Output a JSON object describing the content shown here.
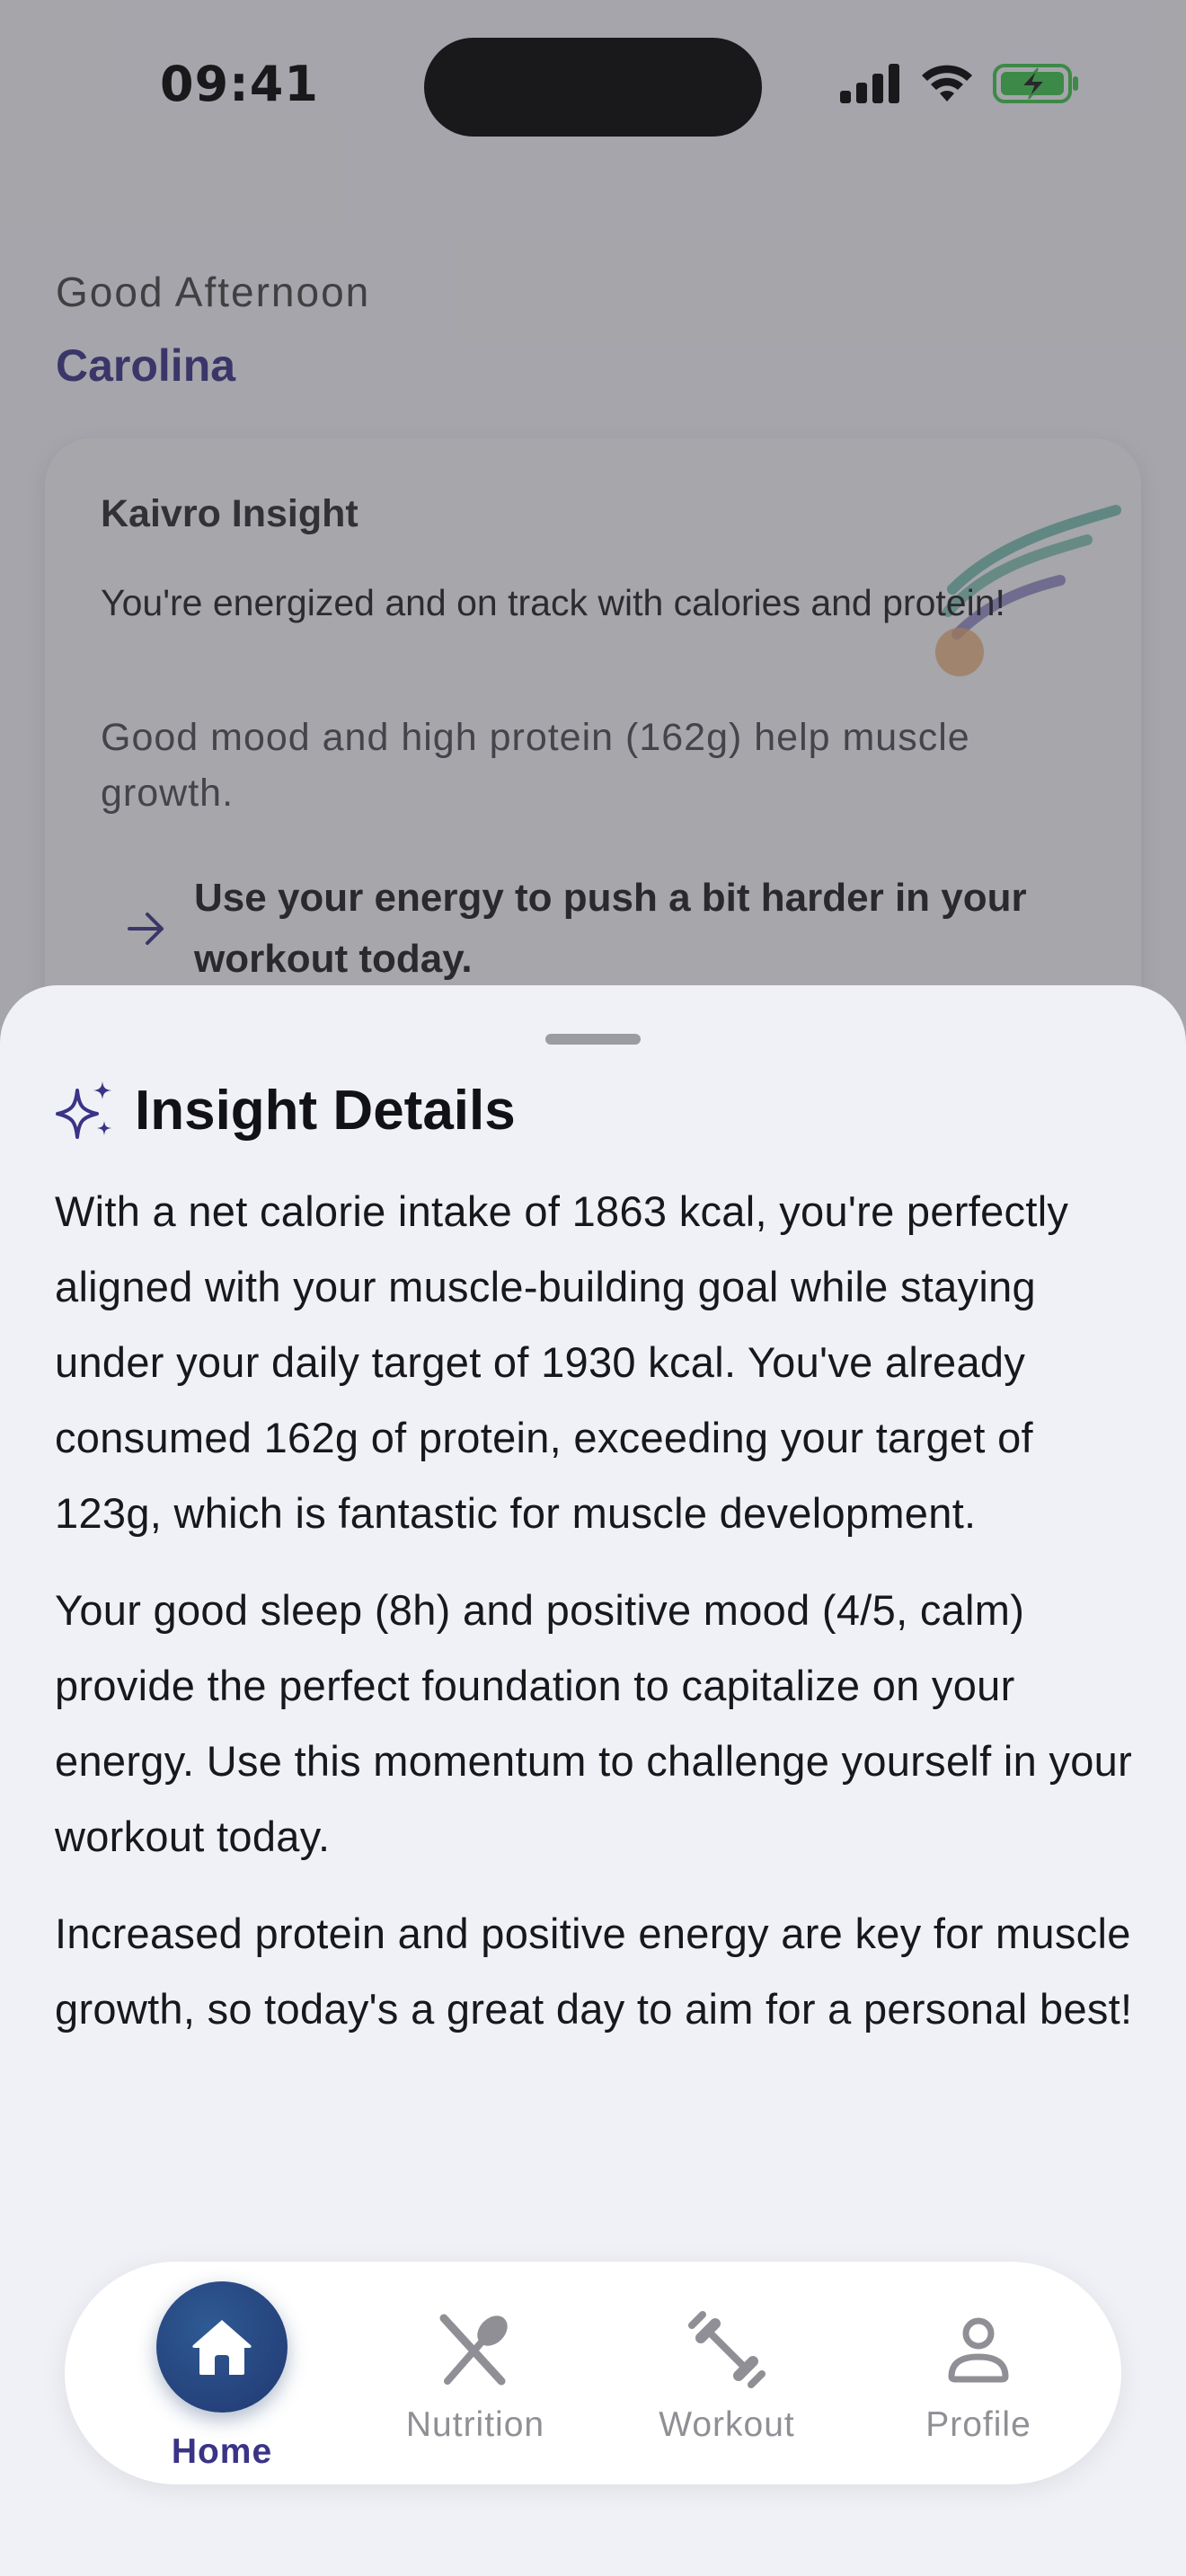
{
  "status_bar": {
    "time": "09:41",
    "icons": [
      "signal-icon",
      "wifi-icon",
      "battery-charging-icon"
    ]
  },
  "home": {
    "greeting": "Good Afternoon",
    "user_name": "Carolina",
    "insight_card": {
      "title": "Kaivro Insight",
      "summary": "You're energized and on track with calories and protein!",
      "detail": "Good mood and high protein (162g) help muscle growth.",
      "action": "Use your energy to push a bit harder in your workout today."
    }
  },
  "sheet": {
    "title": "Insight Details",
    "icon": "sparkles-icon",
    "paragraphs": [
      "With a net calorie intake of 1863 kcal, you're perfectly aligned with your muscle-building goal while staying under your daily target of 1930 kcal. You've already consumed 162g of protein, exceeding your target of 123g, which is fantastic for muscle development.",
      "Your good sleep (8h) and positive mood (4/5, calm) provide the perfect foundation to capitalize on your energy. Use this momentum to challenge yourself in your workout today.",
      "Increased protein and positive energy are key for muscle growth, so today's a great day to aim for a personal best!"
    ]
  },
  "tab_bar": {
    "active": "Home",
    "tabs": [
      {
        "label": "Home",
        "icon": "home-icon"
      },
      {
        "label": "Nutrition",
        "icon": "spoon-knife-icon"
      },
      {
        "label": "Workout",
        "icon": "dumbbell-icon"
      },
      {
        "label": "Profile",
        "icon": "person-icon"
      }
    ]
  },
  "colors": {
    "accent": "#3a3386",
    "home_button": "#25427c",
    "battery": "#3fc24a",
    "tab_inactive": "#8f8f95"
  }
}
